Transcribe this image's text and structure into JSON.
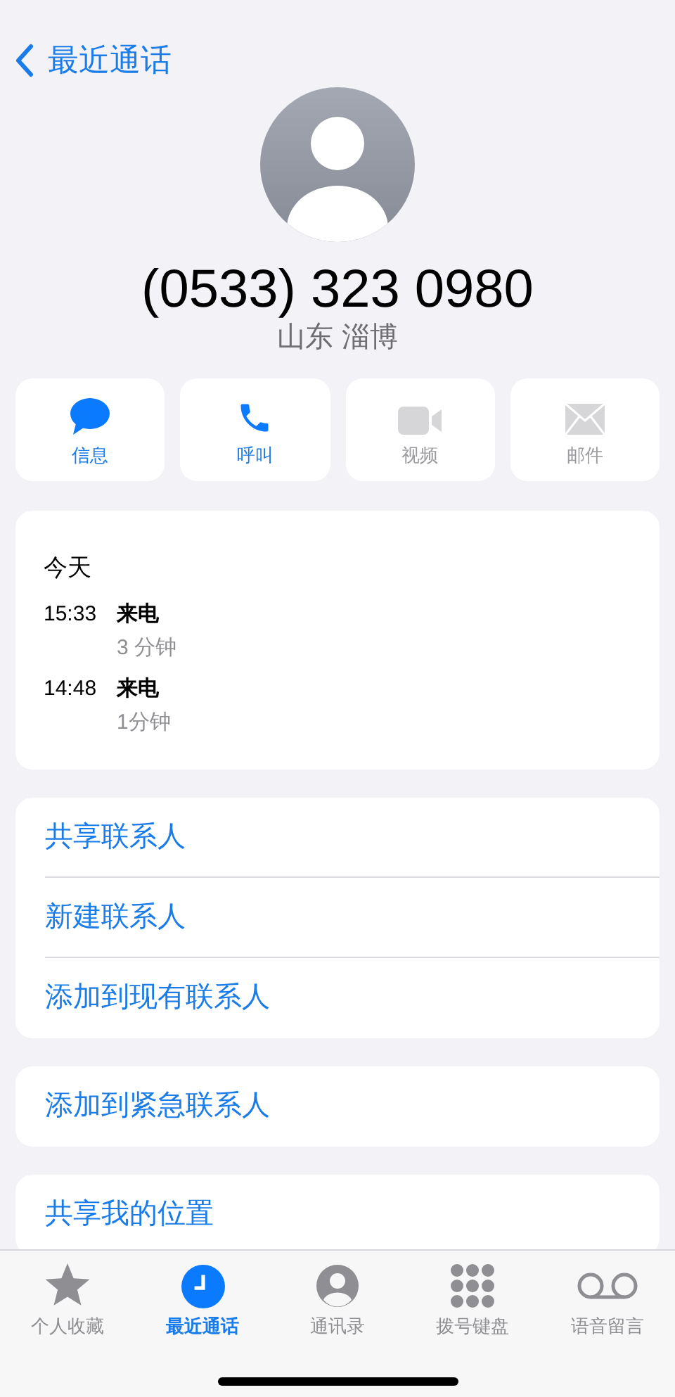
{
  "nav": {
    "back_label": "最近通话"
  },
  "contact": {
    "number": "(0533) 323 0980",
    "location": "山东 淄博"
  },
  "actions": [
    {
      "kind": "message",
      "label": "信息",
      "disabled": false
    },
    {
      "kind": "call",
      "label": "呼叫",
      "disabled": false
    },
    {
      "kind": "video",
      "label": "视频",
      "disabled": true
    },
    {
      "kind": "mail",
      "label": "邮件",
      "disabled": true
    }
  ],
  "call_log": {
    "date": "今天",
    "calls": [
      {
        "time": "15:33",
        "type": "来电",
        "duration": "3 分钟"
      },
      {
        "time": "14:48",
        "type": "来电",
        "duration": "1分钟"
      }
    ]
  },
  "option_groups": [
    [
      "共享联系人",
      "新建联系人",
      "添加到现有联系人"
    ],
    [
      "添加到紧急联系人"
    ],
    [
      "共享我的位置"
    ]
  ],
  "tab_bar": [
    {
      "kind": "favorites",
      "label": "个人收藏",
      "selected": false
    },
    {
      "kind": "recents",
      "label": "最近通话",
      "selected": true
    },
    {
      "kind": "contacts",
      "label": "通讯录",
      "selected": false
    },
    {
      "kind": "keypad",
      "label": "拨号键盘",
      "selected": false
    },
    {
      "kind": "voicemail",
      "label": "语音留言",
      "selected": false
    }
  ]
}
